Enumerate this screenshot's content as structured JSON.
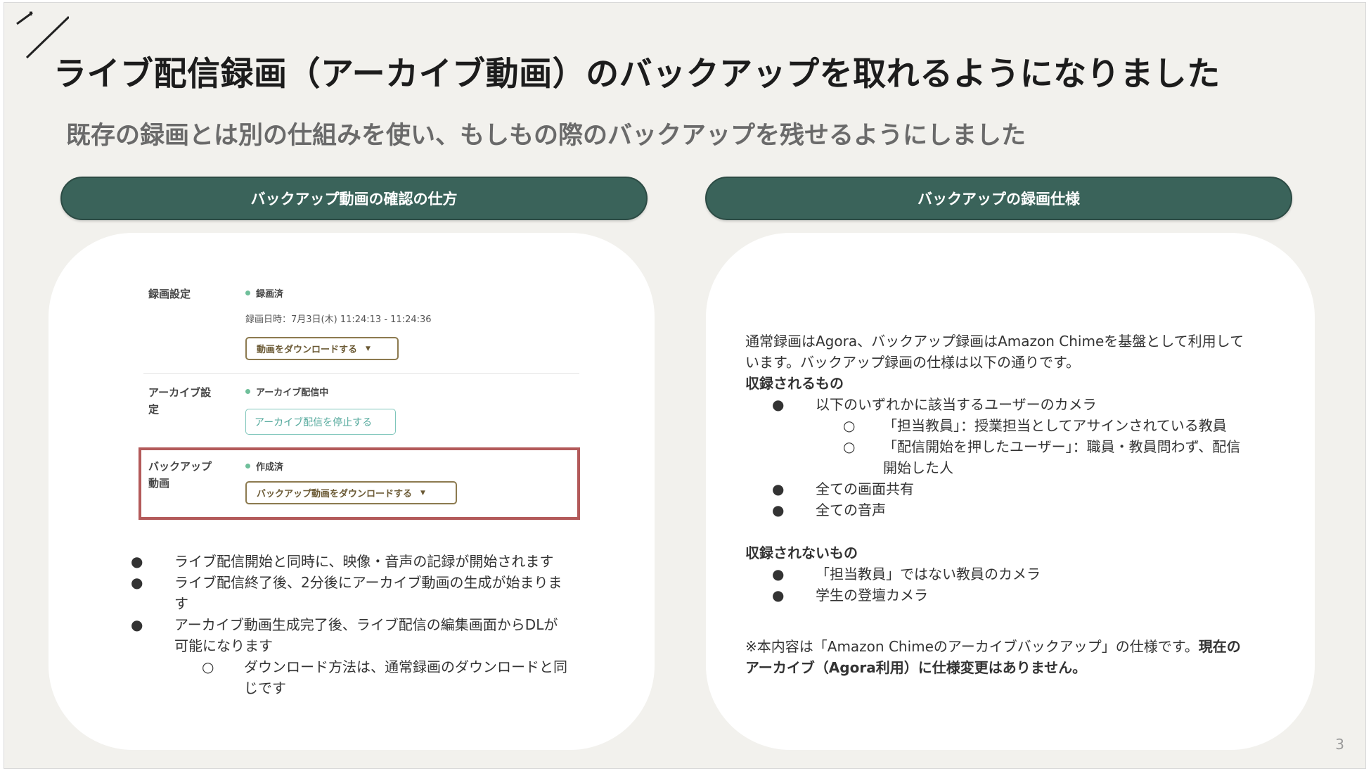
{
  "slide": {
    "title": "ライブ配信録画（アーカイブ動画）のバックアップを取れるようになりました",
    "subtitle": "既存の録画とは別の仕組みを使い、もしもの際のバックアップを残せるようにしました",
    "page_number": "3"
  },
  "left_panel": {
    "header": "バックアップ動画の確認の仕方",
    "settings": {
      "recording": {
        "label": "録画設定",
        "status": "録画済",
        "date": "録画日時：7月3日(木) 11:24:13 - 11:24:36",
        "download_button": "動画をダウンロードする"
      },
      "archive": {
        "label_line1": "アーカイブ設",
        "label_line2": "定",
        "status": "アーカイブ配信中",
        "stop_button": "アーカイブ配信を停止する"
      },
      "backup": {
        "label_line1": "バックアップ",
        "label_line2": "動画",
        "status": "作成済",
        "download_button": "バックアップ動画をダウンロードする"
      }
    },
    "bullets": [
      {
        "lines": [
          "ライブ配信開始と同時に、映像・音声の記録が開始されます"
        ]
      },
      {
        "lines": [
          "ライブ配信終了後、2分後にアーカイブ動画の生成が始ま",
          "す"
        ],
        "line1": "ライブ配信終了後、2分後にアーカイブ動画の生成が始まりま"
      },
      {
        "line1": "アーカイブ動画生成完了後、ライブ配信の編集画面からDLが",
        "line2": "可能になります"
      }
    ],
    "sub_bullet": {
      "line1": "ダウンロード方法は、通常録画のダウンロードと同",
      "line2": "じです"
    },
    "bullet1": "ライブ配信開始と同時に、映像・音声の記録が開始されます",
    "bullet2_line1": "ライブ配信終了後、2分後にアーカイブ動画の生成が始まりま",
    "bullet2_line2": "す",
    "bullet3_line1": "アーカイブ動画生成完了後、ライブ配信の編集画面からDLが",
    "bullet3_line2": "可能になります"
  },
  "right_panel": {
    "header": "バックアップの録画仕様",
    "intro_line1": "通常録画はAgora、バックアップ録画はAmazon Chimeを基盤として利用して",
    "intro_line2": "います。バックアップ録画の仕様は以下の通りです。",
    "recorded_heading": "収録されるもの",
    "recorded_item1": "以下のいずれかに該当するユーザーのカメラ",
    "recorded_sub1": "「担当教員」：授業担当としてアサインされている教員",
    "recorded_sub2_line1": "「配信開始を押したユーザー」：職員・教員問わず、配信",
    "recorded_sub2_line2": "開始した人",
    "recorded_item2": "全ての画面共有",
    "recorded_item3": "全ての音声",
    "not_recorded_heading": "収録されないもの",
    "not_recorded_item1": "「担当教員」ではない教員のカメラ",
    "not_recorded_item2": "学生の登壇カメラ",
    "note_line1_normal": "※本内容は「Amazon Chimeのアーカイブバックアップ」の仕様です。",
    "note_line1_bold": "現在の",
    "note_line2_bold": "アーカイブ（Agora利用）に仕様変更はありません。"
  },
  "colors": {
    "background": "#f2f1ed",
    "header_pill": "#3a635a",
    "highlight_border": "#b35a5a",
    "status_dot": "#6fbf9a"
  }
}
